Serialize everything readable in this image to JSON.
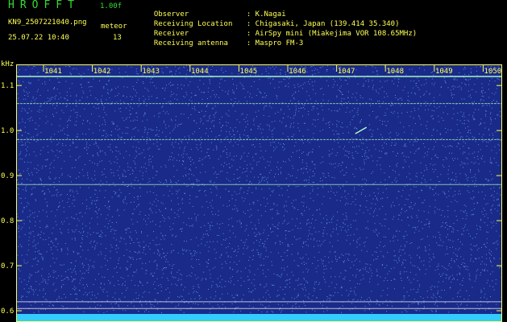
{
  "header": {
    "logo": "HROFFT",
    "version": "1.00f",
    "filename": "KN9_2507221040.png",
    "meteor_label": "meteor",
    "datetime": "25.07.22 10:40",
    "meteor_count": "13",
    "info": [
      {
        "key": "Observer",
        "value": ": K.Nagai"
      },
      {
        "key": "Receiving Location",
        "value": ": Chigasaki, Japan (139.414 35.340)"
      },
      {
        "key": "Receiver",
        "value": ": AirSpy mini (Miakejima VOR 108.65MHz)"
      },
      {
        "key": "Receiving antenna",
        "value": ": Maspro FM-3"
      }
    ]
  },
  "plot": {
    "y_unit": "kHz",
    "x_ticks": [
      "1041",
      "1042",
      "1043",
      "1044",
      "1045",
      "1046",
      "1047",
      "1048",
      "1049",
      "1050"
    ],
    "y_ticks": [
      "1.1",
      "1.0",
      "0.9",
      "0.8",
      "0.7",
      "0.6"
    ],
    "colors": {
      "background": "#1a2a88",
      "noise": "#6fb0ff",
      "line": "#aaffcc",
      "marker": "#ffff55",
      "bottom_strip": "#33ccff"
    },
    "horizontal_lines_khz": [
      1.12,
      1.06,
      0.98,
      0.88,
      0.62,
      0.605
    ],
    "meteor_echoes": [
      {
        "x": "1047.6",
        "y_khz": 1.0
      }
    ]
  }
}
